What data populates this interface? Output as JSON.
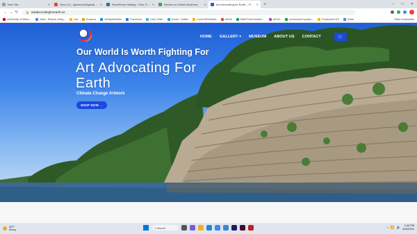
{
  "browser": {
    "tabs": [
      {
        "label": "New Tab",
        "color": "#9aa0a6",
        "active": false
      },
      {
        "label": "Inbox (1) - sjbarrow1@gmail.com",
        "color": "#ea4335",
        "active": false
      },
      {
        "label": "WordPress Hosting - Fast, Secure",
        "color": "#21759b",
        "active": false
      },
      {
        "label": "Review an Online Business",
        "color": "#34a853",
        "active": false
      },
      {
        "label": "Art Advocating for Earth – Fighti",
        "color": "#2f5bc9",
        "active": true
      }
    ],
    "new_tab_glyph": "+",
    "window_controls": [
      "–",
      "□",
      "✕"
    ],
    "nav_glyphs": [
      "←",
      "→",
      "↻"
    ],
    "url": "artadvocatingforearth.us",
    "lock_glyph": "🔒",
    "bookmarks": [
      {
        "label": "University of Wisco...",
        "color": "#c5050c"
      },
      {
        "label": "Main - Barrow, Kelly...",
        "color": "#4285f4"
      },
      {
        "label": "Uat",
        "color": "#fbbc04"
      },
      {
        "label": "Amazon",
        "color": "#ff9900"
      },
      {
        "label": "10DayWeather",
        "color": "#1e88e5"
      },
      {
        "label": "Facebook",
        "color": "#1877f2"
      },
      {
        "label": "Cart | Wish",
        "color": "#2fb7ec"
      },
      {
        "label": "Home / Twitter",
        "color": "#1da1f2"
      },
      {
        "label": "CurrentPortfolios",
        "color": "#f4b400"
      },
      {
        "label": "ArtHill",
        "color": "#db4437"
      },
      {
        "label": "5484 Pass Modern...",
        "color": "#0f9d58"
      },
      {
        "label": "Art211",
        "color": "#ab47bc"
      },
      {
        "label": "environment poster...",
        "color": "#0f9d58"
      },
      {
        "label": "ProductionCDI",
        "color": "#f4b400"
      },
      {
        "label": "Grids",
        "color": "#4285f4"
      }
    ],
    "other_bookmarks": "Other bookmarks"
  },
  "site": {
    "nav": [
      "HOME",
      "GALLERY ▾",
      "MUSEUM",
      "ABOUT US",
      "CONTACT"
    ],
    "cart_glyph": "🛒",
    "tagline": "Our World Is Worth Fighting For",
    "headline": "Art Advocating For Earth",
    "subheadline": "Climate Change Artwork",
    "cta": "SHOP NOW →",
    "accent": "#1a49e0"
  },
  "taskbar": {
    "weather_temp": "53°F",
    "weather_cond": "Sunny",
    "search_label": "Search",
    "time": "2:43 PM",
    "date": "4/29/2022",
    "tray_glyphs": [
      "^",
      "📶",
      "🔊"
    ]
  }
}
